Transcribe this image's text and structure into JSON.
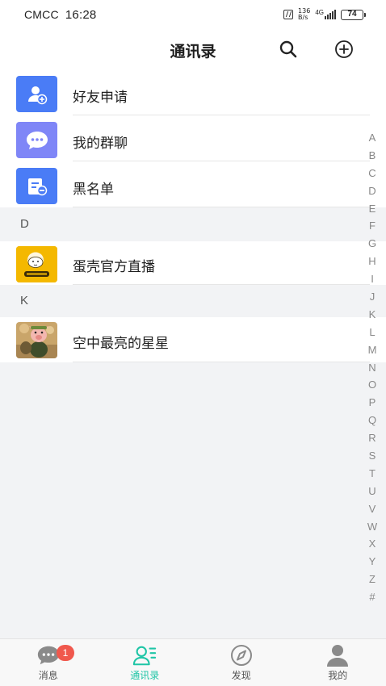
{
  "status_bar": {
    "carrier": "CMCC",
    "time": "16:28",
    "net_speed_value": "136",
    "net_speed_unit": "B/s",
    "network": "4G",
    "battery": "74"
  },
  "header": {
    "title": "通讯录",
    "search_icon": "search-icon",
    "add_icon": "plus-circle-icon"
  },
  "functions": [
    {
      "label": "好友申请",
      "icon": "add-friend-icon",
      "color": "#4a7cf6"
    },
    {
      "label": "我的群聊",
      "icon": "chat-bubble-icon",
      "color": "#7f86f7"
    },
    {
      "label": "黑名单",
      "icon": "blacklist-icon",
      "color": "#4a7cf6"
    }
  ],
  "sections": [
    {
      "letter": "D",
      "contacts": [
        {
          "name": "蛋壳官方直播",
          "avatar": "eggshell-logo"
        }
      ]
    },
    {
      "letter": "K",
      "contacts": [
        {
          "name": "空中最亮的星星",
          "avatar": "cartoon-pig-photo"
        }
      ]
    }
  ],
  "alphabet": [
    "A",
    "B",
    "C",
    "D",
    "E",
    "F",
    "G",
    "H",
    "I",
    "J",
    "K",
    "L",
    "M",
    "N",
    "O",
    "P",
    "Q",
    "R",
    "S",
    "T",
    "U",
    "V",
    "W",
    "X",
    "Y",
    "Z",
    "#"
  ],
  "bottom_nav": {
    "items": [
      {
        "label": "消息",
        "icon": "message-icon",
        "badge": "1"
      },
      {
        "label": "通讯录",
        "icon": "contacts-icon",
        "active": true
      },
      {
        "label": "发现",
        "icon": "compass-icon"
      },
      {
        "label": "我的",
        "icon": "profile-icon"
      }
    ],
    "active_color": "#1fc5a6"
  }
}
